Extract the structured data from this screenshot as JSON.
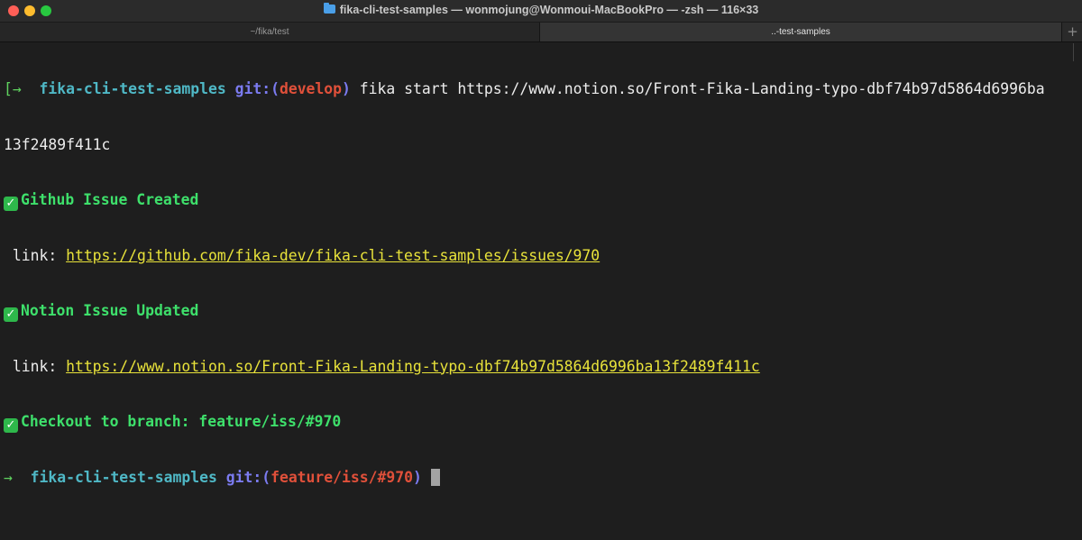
{
  "window": {
    "title": "fika-cli-test-samples — wonmojung@Wonmoui-MacBookPro — -zsh — 116×33"
  },
  "tabs": [
    {
      "label": "~/fika/test"
    },
    {
      "label": "..-test-samples"
    }
  ],
  "tab_add_label": "+",
  "terminal": {
    "line1": {
      "bracket": "[",
      "arrow": "→",
      "dir": "fika-cli-test-samples",
      "git": "git:(",
      "branch": "develop",
      "git_close": ")",
      "command": "fika start https://www.notion.so/Front-Fika-Landing-typo-dbf74b97d5864d6996ba"
    },
    "line2": "13f2489f411c",
    "line3": {
      "icon": "✓",
      "text": "Github Issue Created"
    },
    "line4": {
      "label": " link: ",
      "url": "https://github.com/fika-dev/fika-cli-test-samples/issues/970"
    },
    "line5": {
      "icon": "✓",
      "text": "Notion Issue Updated"
    },
    "line6": {
      "label": " link: ",
      "url": "https://www.notion.so/Front-Fika-Landing-typo-dbf74b97d5864d6996ba13f2489f411c"
    },
    "line7": {
      "icon": "✓",
      "text": "Checkout to branch: feature/iss/#970"
    },
    "line8": {
      "arrow": "→",
      "dir": "fika-cli-test-samples",
      "git": "git:(",
      "branch": "feature/iss/#970",
      "git_close": ")"
    }
  },
  "colors": {
    "background": "#1e1e1e",
    "prompt_dir": "#4fb8c6",
    "git": "#7b7bf0",
    "branch": "#e0503a",
    "success": "#3ee06b",
    "link": "#e8e23a"
  }
}
